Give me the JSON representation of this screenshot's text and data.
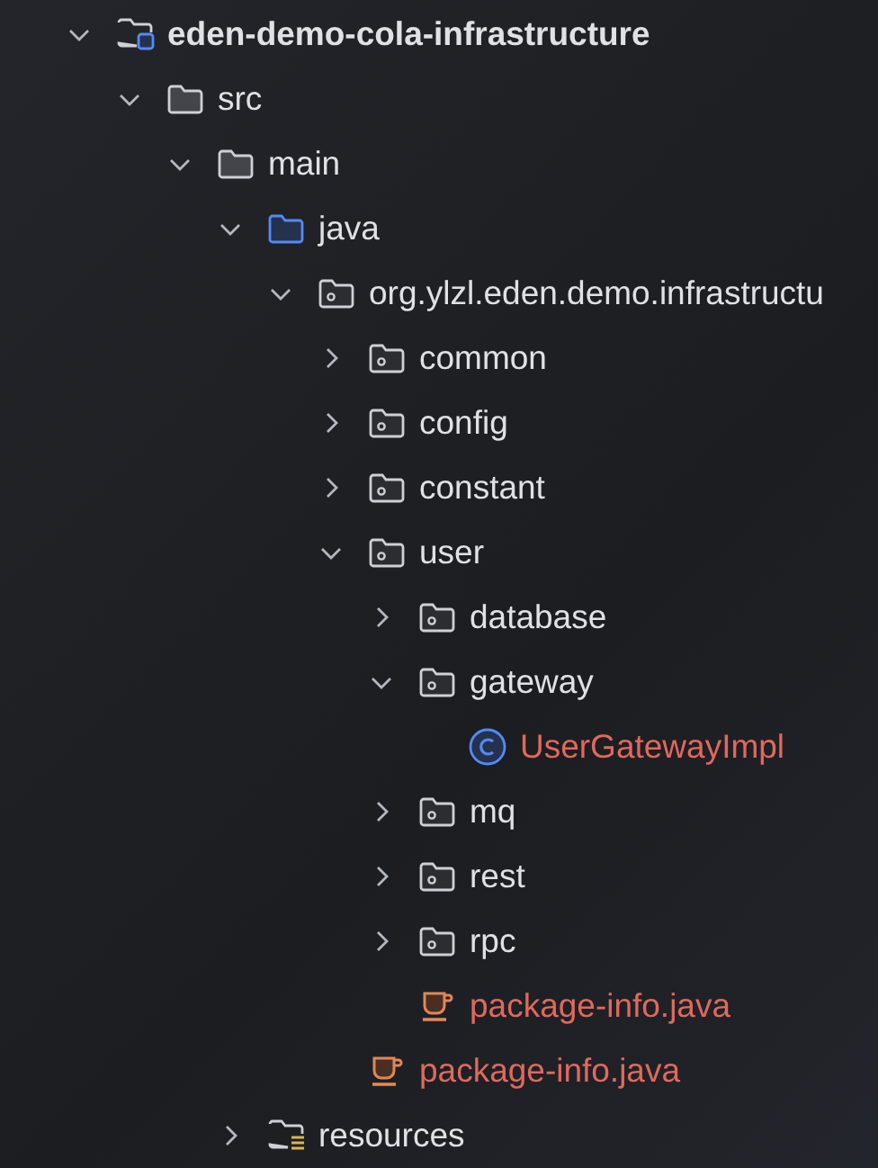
{
  "project_tree": [
    {
      "label": "eden-demo-cola-infrastructure",
      "kind": "module",
      "expanded": true,
      "unversioned": false,
      "children": [
        {
          "label": "src",
          "kind": "folder",
          "expanded": true,
          "unversioned": false,
          "children": [
            {
              "label": "main",
              "kind": "folder",
              "expanded": true,
              "unversioned": false,
              "children": [
                {
                  "label": "java",
                  "kind": "source-root",
                  "expanded": true,
                  "unversioned": false,
                  "children": [
                    {
                      "label": "org.ylzl.eden.demo.infrastructu",
                      "kind": "package",
                      "expanded": true,
                      "unversioned": false,
                      "children": [
                        {
                          "label": "common",
                          "kind": "package",
                          "expanded": false,
                          "unversioned": false
                        },
                        {
                          "label": "config",
                          "kind": "package",
                          "expanded": false,
                          "unversioned": false
                        },
                        {
                          "label": "constant",
                          "kind": "package",
                          "expanded": false,
                          "unversioned": false
                        },
                        {
                          "label": "user",
                          "kind": "package",
                          "expanded": true,
                          "unversioned": false,
                          "children": [
                            {
                              "label": "database",
                              "kind": "package",
                              "expanded": false,
                              "unversioned": false
                            },
                            {
                              "label": "gateway",
                              "kind": "package",
                              "expanded": true,
                              "unversioned": false,
                              "children": [
                                {
                                  "label": "UserGatewayImpl",
                                  "kind": "class",
                                  "unversioned": true
                                }
                              ]
                            },
                            {
                              "label": "mq",
                              "kind": "package",
                              "expanded": false,
                              "unversioned": false
                            },
                            {
                              "label": "rest",
                              "kind": "package",
                              "expanded": false,
                              "unversioned": false
                            },
                            {
                              "label": "rpc",
                              "kind": "package",
                              "expanded": false,
                              "unversioned": false
                            },
                            {
                              "label": "package-info.java",
                              "kind": "java-file",
                              "unversioned": true
                            }
                          ]
                        },
                        {
                          "label": "package-info.java",
                          "kind": "java-file",
                          "unversioned": true
                        }
                      ]
                    }
                  ]
                },
                {
                  "label": "resources",
                  "kind": "resources",
                  "expanded": false,
                  "unversioned": false
                }
              ]
            }
          ]
        }
      ]
    }
  ]
}
